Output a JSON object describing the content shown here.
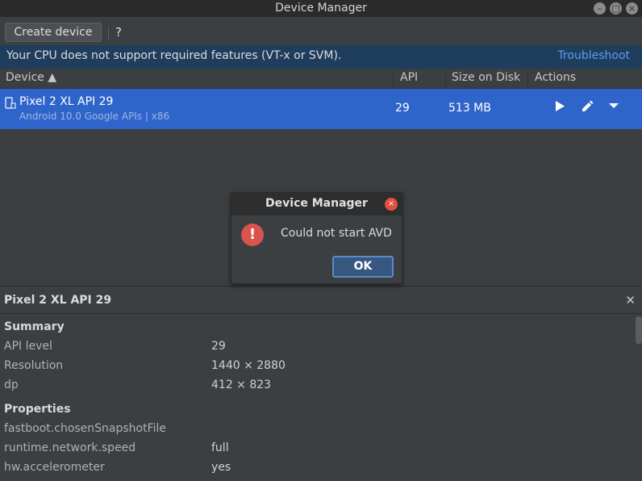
{
  "window": {
    "title": "Device Manager",
    "controls": {
      "minimize": "–",
      "maximize": "□",
      "close": "×"
    }
  },
  "toolbar": {
    "create_label": "Create device",
    "help_label": "?"
  },
  "banner": {
    "message": "Your CPU does not support required features (VT-x or SVM).",
    "link": "Troubleshoot"
  },
  "table": {
    "headers": {
      "device": "Device ▲",
      "api": "API",
      "size": "Size on Disk",
      "actions": "Actions"
    },
    "rows": [
      {
        "name": "Pixel 2 XL API 29",
        "subtitle": "Android 10.0 Google APIs | x86",
        "api": "29",
        "size": "513 MB",
        "actions": [
          "play-icon",
          "edit-icon",
          "dropdown-icon"
        ]
      }
    ]
  },
  "dialog": {
    "title": "Device Manager",
    "close": "×",
    "icon": "!",
    "message": "Could not start AVD",
    "ok_label": "OK"
  },
  "details": {
    "title": "Pixel 2 XL API 29",
    "close": "✕",
    "summary_label": "Summary",
    "summary": [
      {
        "key": "API level",
        "value": "29"
      },
      {
        "key": "Resolution",
        "value": "1440 × 2880"
      },
      {
        "key": "dp",
        "value": "412 × 823"
      }
    ],
    "properties_label": "Properties",
    "properties": [
      {
        "key": "fastboot.chosenSnapshotFile",
        "value": ""
      },
      {
        "key": "runtime.network.speed",
        "value": "full"
      },
      {
        "key": "hw.accelerometer",
        "value": "yes"
      }
    ]
  },
  "colors": {
    "selection": "#2f65ca",
    "banner": "#1f3d5c",
    "link": "#589df6",
    "error": "#d9534f"
  }
}
